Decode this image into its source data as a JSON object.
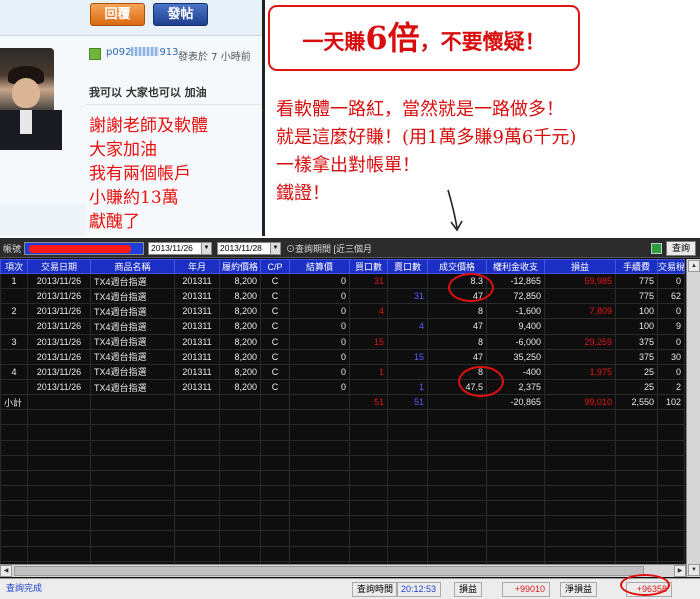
{
  "forum": {
    "reply_label": "回覆",
    "post_label": "發帖",
    "user_prefix": "p092",
    "user_suffix": "913",
    "post_time": "發表於 7 小時前",
    "post_title": "我可以 大家也可以 加油",
    "body_lines": [
      "謝謝老師及軟體",
      "大家加油",
      "我有兩個帳戶",
      "小賺約13萬",
      "獻醜了"
    ]
  },
  "annotation": {
    "headline_pre": "一天賺",
    "headline_big": "6倍",
    "headline_post": "，不要懷疑！",
    "lines": [
      "看軟體一路紅，當然就是一路做多！",
      "就是這麼好賺！(用1萬多賺9萬6千元)",
      "一樣拿出對帳單！",
      "鐵證！"
    ]
  },
  "app": {
    "account_label": "帳號",
    "date_from": "2013/11/26",
    "date_to": "2013/11/28",
    "period_label": "查詢期間 [近三個月",
    "query_button": "查詢",
    "columns": [
      "項次",
      "交易日期",
      "商品名稱",
      "年月",
      "履約價格",
      "C/P",
      "結算價",
      "買口數",
      "賣口數",
      "成交價格",
      "權利金收支",
      "損益",
      "手續費",
      "交易稅"
    ],
    "rows": [
      {
        "no": "1",
        "date": "2013/11/26",
        "product": "TX4週台指選",
        "ym": "201311",
        "strike": "8,200",
        "cp": "C",
        "settle": "0",
        "buy": "31",
        "sell": "",
        "price": "8.3",
        "premium": "-12,865",
        "pnl": "59,985",
        "fee": "775",
        "tax": "0"
      },
      {
        "no": "",
        "date": "2013/11/26",
        "product": "TX4週台指選",
        "ym": "201311",
        "strike": "8,200",
        "cp": "C",
        "settle": "0",
        "buy": "",
        "sell": "31",
        "price": "47",
        "premium": "72,850",
        "pnl": "",
        "fee": "775",
        "tax": "62"
      },
      {
        "no": "2",
        "date": "2013/11/26",
        "product": "TX4週台指選",
        "ym": "201311",
        "strike": "8,200",
        "cp": "C",
        "settle": "0",
        "buy": "4",
        "sell": "",
        "price": "8",
        "premium": "-1,600",
        "pnl": "7,809",
        "fee": "100",
        "tax": "0"
      },
      {
        "no": "",
        "date": "2013/11/26",
        "product": "TX4週台指選",
        "ym": "201311",
        "strike": "8,200",
        "cp": "C",
        "settle": "0",
        "buy": "",
        "sell": "4",
        "price": "47",
        "premium": "9,400",
        "pnl": "",
        "fee": "100",
        "tax": "9"
      },
      {
        "no": "3",
        "date": "2013/11/26",
        "product": "TX4週台指選",
        "ym": "201311",
        "strike": "8,200",
        "cp": "C",
        "settle": "0",
        "buy": "15",
        "sell": "",
        "price": "8",
        "premium": "-6,000",
        "pnl": "29,259",
        "fee": "375",
        "tax": "0"
      },
      {
        "no": "",
        "date": "2013/11/26",
        "product": "TX4週台指選",
        "ym": "201311",
        "strike": "8,200",
        "cp": "C",
        "settle": "0",
        "buy": "",
        "sell": "15",
        "price": "47",
        "premium": "35,250",
        "pnl": "",
        "fee": "375",
        "tax": "30"
      },
      {
        "no": "4",
        "date": "2013/11/26",
        "product": "TX4週台指選",
        "ym": "201311",
        "strike": "8,200",
        "cp": "C",
        "settle": "0",
        "buy": "1",
        "sell": "",
        "price": "8",
        "premium": "-400",
        "pnl": "1,975",
        "fee": "25",
        "tax": "0"
      },
      {
        "no": "",
        "date": "2013/11/26",
        "product": "TX4週台指選",
        "ym": "201311",
        "strike": "8,200",
        "cp": "C",
        "settle": "0",
        "buy": "",
        "sell": "1",
        "price": "47.5",
        "premium": "2,375",
        "pnl": "",
        "fee": "25",
        "tax": "2"
      }
    ],
    "subtotal": {
      "label": "小計",
      "buy": "51",
      "sell": "51",
      "premium": "-20,865",
      "pnl": "99,010",
      "fee": "2,550",
      "tax": "102"
    },
    "status": {
      "done": "查詢完成",
      "time_label": "查詢時間",
      "time": "20:12:53",
      "pnl_label": "損益",
      "pnl": "+99010",
      "net_label": "淨損益",
      "net": "+96358"
    }
  }
}
